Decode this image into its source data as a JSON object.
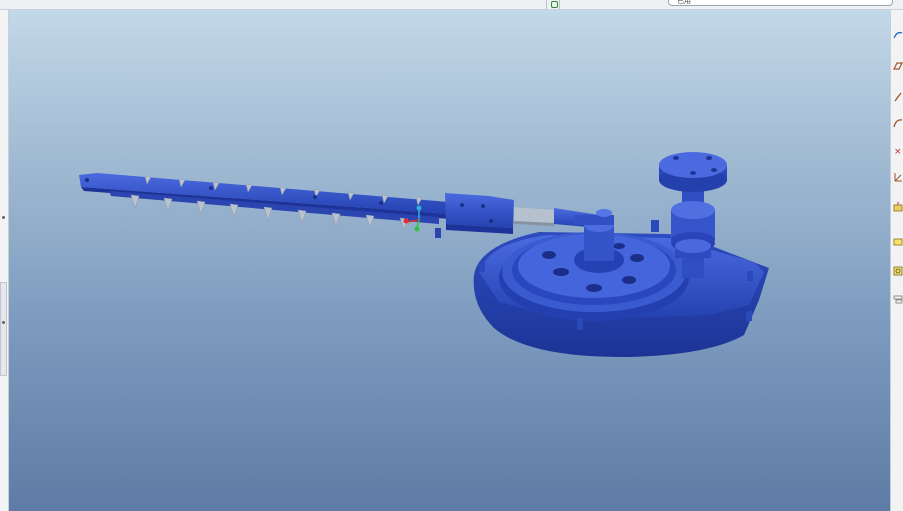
{
  "window": {
    "search_text": "已用"
  },
  "viewport": {
    "model_color": "#3557c8",
    "background_top": "#c3d8e8",
    "background_bottom": "#5e7ba5",
    "axis_colors": {
      "x": "#e03030",
      "y": "#30c040",
      "z": "#30b0d8"
    }
  },
  "toolbar": {
    "tools": [
      {
        "name": "sketch-tool-icon"
      },
      {
        "name": "plane-tool-icon"
      },
      {
        "name": "axis-tool-icon"
      },
      {
        "name": "curve-tool-icon"
      },
      {
        "name": "point-tool-icon"
      },
      {
        "name": "coordinate-system-icon"
      },
      {
        "name": "analysis-tool-icon"
      },
      {
        "name": "annotation-tool-icon"
      },
      {
        "name": "view-tool-icon"
      },
      {
        "name": "layer-tool-icon"
      }
    ]
  }
}
